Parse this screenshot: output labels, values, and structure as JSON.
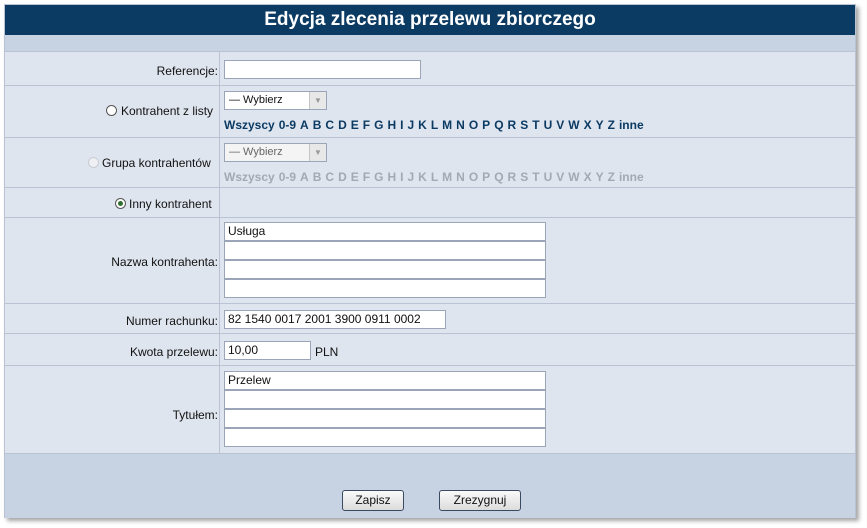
{
  "header": {
    "title": "Edycja zlecenia przelewu zbiorczego"
  },
  "form": {
    "reference_label": "Referencje:",
    "reference_value": "",
    "contractor_list_label": "Kontrahent z listy",
    "contractor_list_select": "— Wybierz",
    "group_label": "Grupa kontrahentów",
    "group_select": "— Wybierz",
    "other_label": "Inny kontrahent",
    "name_label": "Nazwa kontrahenta:",
    "name_lines": [
      "Usługa",
      "",
      "",
      ""
    ],
    "account_label": "Numer rachunku:",
    "account_value": "82 1540 0017 2001 3900 0911 0002",
    "amount_label": "Kwota przelewu:",
    "amount_value": "10,00",
    "currency": "PLN",
    "title_label": "Tytułem:",
    "title_lines": [
      "Przelew",
      "",
      "",
      ""
    ]
  },
  "alphabet": [
    "Wszyscy",
    "0-9",
    "A",
    "B",
    "C",
    "D",
    "E",
    "F",
    "G",
    "H",
    "I",
    "J",
    "K",
    "L",
    "M",
    "N",
    "O",
    "P",
    "Q",
    "R",
    "S",
    "T",
    "U",
    "V",
    "W",
    "X",
    "Y",
    "Z",
    "inne"
  ],
  "buttons": {
    "save": "Zapisz",
    "cancel": "Zrezygnuj"
  },
  "colors": {
    "header_bg": "#0b3a63",
    "panel_bg": "#dfe5ef",
    "link": "#0b3a63"
  }
}
